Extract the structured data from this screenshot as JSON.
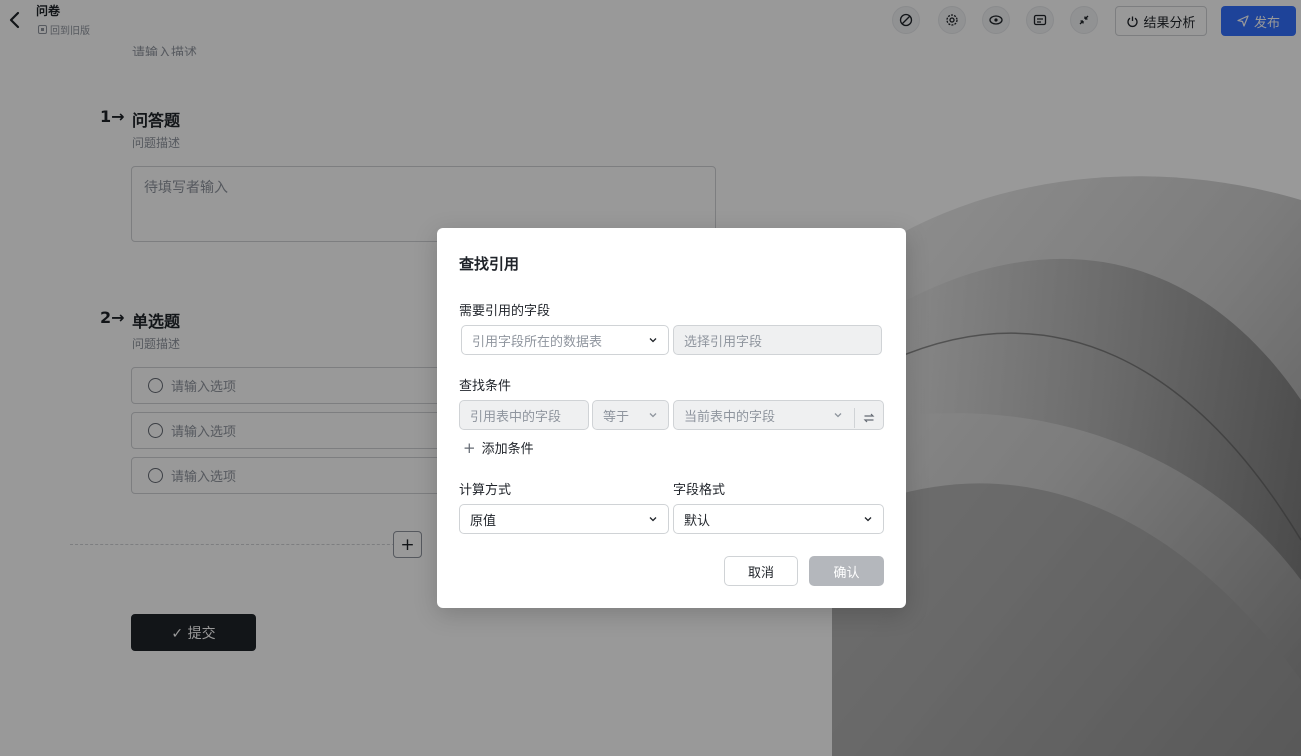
{
  "header": {
    "title": "问卷",
    "old_version_label": "回到旧版",
    "analysis_label": "结果分析",
    "publish_label": "发布",
    "publish_color": "#3370ff"
  },
  "form": {
    "description_placeholder": "请输入描述",
    "questions": [
      {
        "number": "1→",
        "title": "问答题",
        "description": "问题描述",
        "answer_placeholder": "待填写者输入"
      },
      {
        "number": "2→",
        "title": "单选题",
        "description": "问题描述",
        "options": [
          "请输入选项",
          "请输入选项",
          "请输入选项"
        ]
      }
    ],
    "add_question_label": "+",
    "submit_label": "✓ 提交"
  },
  "modal": {
    "title": "查找引用",
    "field_section_label": "需要引用的字段",
    "source_table_placeholder": "引用字段所在的数据表",
    "reference_field_placeholder": "选择引用字段",
    "condition_section_label": "查找条件",
    "condition_field_placeholder": "引用表中的字段",
    "condition_operator": "等于",
    "condition_current_field_placeholder": "当前表中的字段",
    "add_condition_label": "添加条件",
    "calc_label": "计算方式",
    "calc_value": "原值",
    "format_label": "字段格式",
    "format_value": "默认",
    "cancel_label": "取消",
    "confirm_label": "确认"
  }
}
